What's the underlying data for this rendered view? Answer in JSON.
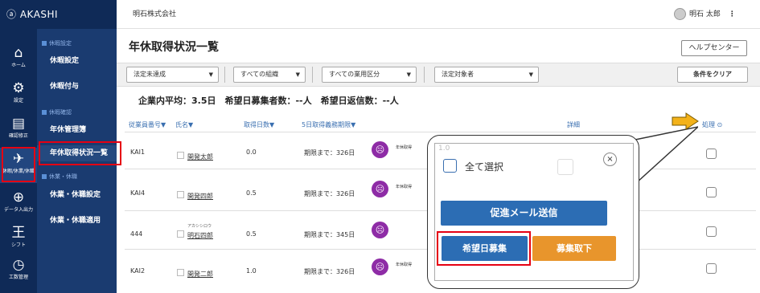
{
  "brand": "AKASHI",
  "rail": [
    {
      "label": "ホーム",
      "icon": "home-icon"
    },
    {
      "label": "設定",
      "icon": "gear-icon"
    },
    {
      "label": "確認修正",
      "icon": "clipboard-icon"
    },
    {
      "label": "休暇/休業/休職",
      "icon": "plane-icon"
    },
    {
      "label": "データ入出力",
      "icon": "download-icon"
    },
    {
      "label": "シフト",
      "icon": "shift-icon"
    },
    {
      "label": "工数管理",
      "icon": "clock-icon"
    }
  ],
  "sub": {
    "sec1": "休暇設定",
    "item1": "休暇設定",
    "item2": "休暇付与",
    "sec2": "休暇確認",
    "item3": "年休管理簿",
    "item4": "年休取得状況一覧",
    "sec3": "休業・休職",
    "item5": "休業・休職設定",
    "item6": "休業・休職適用"
  },
  "header": {
    "company": "明石株式会社",
    "user": "明石 太郎",
    "menu": "⋮"
  },
  "page": {
    "title": "年休取得状況一覧",
    "help": "ヘルプセンター"
  },
  "filters": {
    "f1": "法定未達成",
    "f2": "すべての組織",
    "f3": "すべての業用区分",
    "f4": "法定対象者",
    "clear": "条件をクリア"
  },
  "summary": "企業内平均：3.5日　希望日募集者数：--人　希望日返信数：--人",
  "columns": {
    "id": "従業員番号▼",
    "name": "氏名▼",
    "days": "取得日数▼",
    "deadline": "5日取得義務期限▼",
    "detail": "詳細",
    "action": "処理"
  },
  "rows": [
    {
      "id": "KAI1",
      "kana": "",
      "name": "開発太郎",
      "days": "0.0",
      "deadline": "期限まで：326日",
      "note": "年休取得",
      "extra": "01"
    },
    {
      "id": "KAI4",
      "kana": "",
      "name": "開発四郎",
      "days": "0.5",
      "deadline": "期限まで：326日",
      "note": "年休取得",
      "extra": ""
    },
    {
      "id": "444",
      "kana": "アカシシロウ",
      "name": "明石四郎",
      "days": "0.5",
      "deadline": "期限まで：345日",
      "note": "年休取得",
      "extra": "0"
    },
    {
      "id": "KAI2",
      "kana": "",
      "name": "開発二郎",
      "days": "1.0",
      "deadline": "期限まで：326日",
      "note": "年休取得",
      "extra": "1"
    }
  ],
  "popup": {
    "select_all": "全て選択",
    "close": "×",
    "promo": "促進メール送信",
    "recruit": "希望日募集",
    "withdraw": "募集取下"
  },
  "colors": {
    "rail": "#0f2a57",
    "sub": "#1a3b70",
    "primary": "#2c6db4",
    "orange": "#e8952c",
    "highlight": "#e60012",
    "face": "#8e2ca6"
  }
}
